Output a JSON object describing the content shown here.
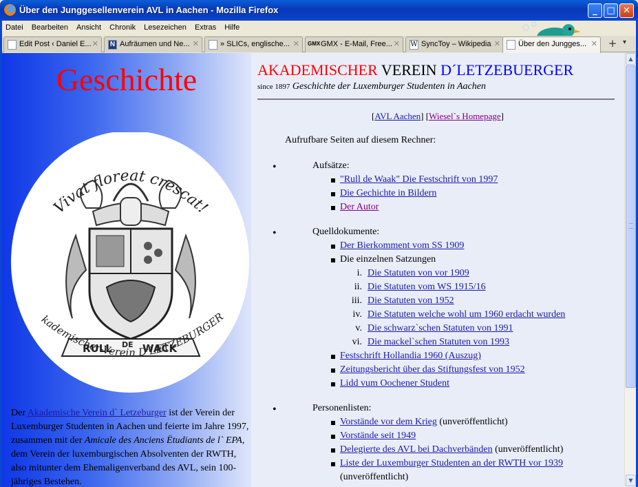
{
  "window": {
    "title": "Über den Junggesellenverein AVL in Aachen - Mozilla Firefox",
    "minimize": "_",
    "maximize": "□",
    "close": "✕"
  },
  "menu": [
    "Datei",
    "Bearbeiten",
    "Ansicht",
    "Chronik",
    "Lesezeichen",
    "Extras",
    "Hilfe"
  ],
  "tabs": [
    {
      "label": "Edit Post ‹ Daniel E...",
      "icon": "page-icon"
    },
    {
      "label": "Aufräumen und Ne...",
      "icon": "n-icon"
    },
    {
      "label": "» SLICs, englische...",
      "icon": "page-icon"
    },
    {
      "label": "GMX - E-Mail, Free...",
      "icon": "gmx-icon",
      "icon_text": "GMX"
    },
    {
      "label": "SyncToy – Wikipedia",
      "icon": "wikipedia-icon",
      "icon_text": "W"
    },
    {
      "label": "Über den Jungges...",
      "icon": "page-icon",
      "active": true
    }
  ],
  "tab_close": "✕",
  "new_tab": "+",
  "tab_list": "▾",
  "page": {
    "left_title": "Geschichte",
    "emblem": {
      "motto": "Vivat floreat crescat!",
      "ribbon_left": "RULL",
      "ribbon_mid": "DE",
      "ribbon_right": "WACK",
      "bottom_text": "Akademischer-Verein D'LETZEBURGER."
    },
    "left_paragraph": {
      "pre": "Der ",
      "link": "Akademische Verein d` Letzeburger",
      "mid1": " ist der Verein der Luxemburger Studenten in Aachen und feierte im Jahre 1997, zusammen mit der ",
      "italic": "Amicale des Anciens Ëtudiants de l` EPA",
      "mid2": ", dem Verein der luxemburgischen Absolventen der RWTH, also mitunter dem Ehemaligenverband des AVL, sein 100-jähriges Bestehen."
    },
    "header": {
      "word1": "AKADEMISCHER",
      "word2": "VEREIN",
      "word3": "D´LETZEBUERGER",
      "since": "since 1897",
      "subtitle": "Geschichte der Luxemburger Studenten in Aachen",
      "color1": "#ff0000",
      "color2": "#000000",
      "color3": "#0000ff"
    },
    "nav": {
      "link1": "AVL Aachen",
      "link2": "Wiesel`s Homepage"
    },
    "intro": "Aufrufbare Seiten auf diesem Rechner:",
    "sections": {
      "aufsaetze": {
        "heading": "Aufsätze:",
        "items": [
          "\"Rull de Waak\" Die Festschrift von 1997",
          "Die Gechichte in Bildern",
          "Der Autor"
        ]
      },
      "quelldokumente": {
        "heading": "Quelldokumente:",
        "item1": "Der Bierkomment vom SS 1909",
        "item2": "Die einzelnen Satzungen",
        "roman": [
          {
            "num": "i.",
            "label": "Die Statuten von vor 1909"
          },
          {
            "num": "ii.",
            "label": "Die Statuten vom WS 1915/16"
          },
          {
            "num": "iii.",
            "label": "Die Statuten von 1952"
          },
          {
            "num": "iv.",
            "label": "Die Statuten welche wohl um 1960 erdacht wurden"
          },
          {
            "num": "v.",
            "label": "Die schwarz`schen Statuten von 1991"
          },
          {
            "num": "vi.",
            "label": "Die mackel`schen Statuten von 1993"
          }
        ],
        "rest": [
          "Festschrift Hollandia 1960 (Auszug)",
          "Zeitungsbericht über das Stiftungsfest von 1952",
          "Lidd vum Oochener Student"
        ]
      },
      "personen": {
        "heading": "Personenlisten:",
        "items": [
          {
            "link": "Vorstände vor dem Krieg",
            "note": " (unveröffentlicht)"
          },
          {
            "link": "Vorstände seit 1949",
            "note": ""
          },
          {
            "link": "Delegierte des AVL bei Dachverbänden",
            "note": " (unveröffentlicht)"
          },
          {
            "link": "Liste der Luxemburger Studenten an der RWTH vor 1939",
            "note": ""
          }
        ],
        "last_note": "(unveröffentlicht)"
      }
    }
  },
  "scrollbar": {
    "up": "▲",
    "down": "▼"
  }
}
